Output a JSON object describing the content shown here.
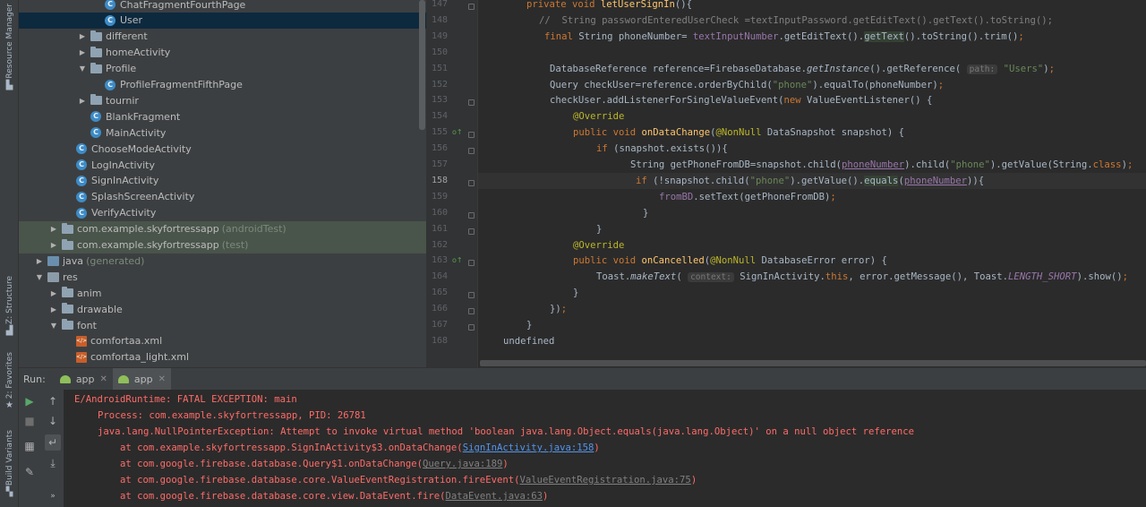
{
  "left_strip": {
    "resource_manager": "Resource Manager",
    "structure": "Z: Structure",
    "favorites": "2: Favorites",
    "build_variants": "Build Variants"
  },
  "tree": [
    {
      "label": "ChatFragmentFourthPage",
      "icon": "class-icon",
      "indent": 4,
      "arrow": ""
    },
    {
      "label": "User",
      "icon": "class-icon",
      "indent": 4,
      "arrow": "",
      "selected": true
    },
    {
      "label": "different",
      "icon": "folder-icon",
      "indent": 3,
      "arrow": "▶"
    },
    {
      "label": "homeActivity",
      "icon": "folder-icon",
      "indent": 3,
      "arrow": "▶"
    },
    {
      "label": "Profile",
      "icon": "folder-icon",
      "indent": 3,
      "arrow": "▼"
    },
    {
      "label": "ProfileFragmentFifthPage",
      "icon": "class-icon",
      "indent": 4,
      "arrow": ""
    },
    {
      "label": "tournir",
      "icon": "folder-icon",
      "indent": 3,
      "arrow": "▶"
    },
    {
      "label": "BlankFragment",
      "icon": "class-icon",
      "indent": 3,
      "arrow": ""
    },
    {
      "label": "MainActivity",
      "icon": "class-icon",
      "indent": 3,
      "arrow": ""
    },
    {
      "label": "ChooseModeActivity",
      "icon": "class-icon",
      "indent": 2,
      "arrow": ""
    },
    {
      "label": "LogInActivity",
      "icon": "class-icon",
      "indent": 2,
      "arrow": ""
    },
    {
      "label": "SignInActivity",
      "icon": "class-icon",
      "indent": 2,
      "arrow": ""
    },
    {
      "label": "SplashScreenActivity",
      "icon": "class-icon",
      "indent": 2,
      "arrow": ""
    },
    {
      "label": "VerifyActivity",
      "icon": "class-icon",
      "indent": 2,
      "arrow": ""
    },
    {
      "label": "com.example.skyfortressapp",
      "hint": "(androidTest)",
      "icon": "folder-icon",
      "indent": 1,
      "arrow": "▶",
      "test": true
    },
    {
      "label": "com.example.skyfortressapp",
      "hint": "(test)",
      "icon": "folder-icon",
      "indent": 1,
      "arrow": "▶",
      "test": true
    },
    {
      "label": "java",
      "hint": "(generated)",
      "icon": "java-folder-icon",
      "indent": 0,
      "arrow": "▶"
    },
    {
      "label": "res",
      "icon": "res-folder-icon",
      "indent": 0,
      "arrow": "▼"
    },
    {
      "label": "anim",
      "icon": "folder-icon",
      "indent": 1,
      "arrow": "▶"
    },
    {
      "label": "drawable",
      "icon": "folder-icon",
      "indent": 1,
      "arrow": "▶"
    },
    {
      "label": "font",
      "icon": "folder-icon",
      "indent": 1,
      "arrow": "▼"
    },
    {
      "label": "comfortaa.xml",
      "icon": "xml-icon",
      "indent": 2,
      "arrow": ""
    },
    {
      "label": "comfortaa_light.xml",
      "icon": "xml-icon",
      "indent": 2,
      "arrow": ""
    }
  ],
  "editor": {
    "line_numbers": [
      "147",
      "148",
      "149",
      "150",
      "151",
      "152",
      "153",
      "154",
      "155",
      "156",
      "157",
      "158",
      "159",
      "160",
      "161",
      "162",
      "163",
      "164",
      "165",
      "166",
      "167",
      "168"
    ],
    "current_line": "158",
    "lines": [
      "<span class='kw'>private void </span><span class='fn'>letUserSignIn</span>(){",
      "<span class='cm'>//  String passwordEnteredUserCheck =textInputPassword.getEditText().getText().toString();</span>",
      "<span class='kw'>final </span>String phoneNumber= <span class='fld'>textInputNumber</span>.getEditText().<span class='hl'>getText</span>().toString().trim()<span class='kw'>;</span>",
      "",
      "DatabaseReference reference=FirebaseDatabase.<i>getInstance</i>().getReference( <span class='hint'>path:</span> <span class='str'>\"Users\"</span>)<span class='kw'>;</span>",
      "Query checkUser=reference.orderByChild(<span class='str'>\"phone\"</span>).equalTo(phoneNumber)<span class='kw'>;</span>",
      "checkUser.addListenerForSingleValueEvent(<span class='kw'>new </span>ValueEventListener() {",
      "<span class='ann'>@Override</span>",
      "<span class='kw'>public void </span><span class='fn'>onDataChange</span>(<span class='ann'>@NonNull </span>DataSnapshot snapshot) {",
      "<span class='kw'>if </span>(snapshot.exists()){",
      "String getPhoneFromDB=snapshot.child(<span class='fld und'>phoneNumber</span>).child(<span class='str'>\"phone\"</span>).getValue(String.<span class='kw'>class</span>)<span class='kw'>;</span>",
      "<span class='kw'>if </span>(!snapshot.child(<span class='str'>\"phone\"</span>).getValue().<span class='hl'>equals</span>(<span class='fld und'>phoneNumber</span>)){",
      "<span class='fld'>fromBD</span>.setText(getPhoneFromDB)<span class='kw'>;</span>",
      "}",
      "}",
      "<span class='ann'>@Override</span>",
      "<span class='kw'>public void </span><span class='fn'>onCancelled</span>(<span class='ann'>@NonNull </span>DatabaseError error) {",
      "Toast.<i>makeText</i>( <span class='hint'>context:</span> SignInActivity.<span class='kw'>this</span>, error.getMessage(), Toast.<span class='it'>LENGTH_SHORT</span>).show()<span class='kw'>;</span>",
      "}",
      "})<span class='kw'>;</span>",
      "}"
    ]
  },
  "run": {
    "title": "Run:",
    "tabs": [
      "app",
      "app"
    ]
  },
  "console": [
    {
      "text": "E/AndroidRuntime: FATAL EXCEPTION: main",
      "indent": 0
    },
    {
      "text": "Process: com.example.skyfortressapp, PID: 26781",
      "indent": 1
    },
    {
      "text": "java.lang.NullPointerException: Attempt to invoke virtual method 'boolean java.lang.Object.equals(java.lang.Object)' on a null object reference",
      "indent": 1
    },
    {
      "prefix": "at com.example.skyfortressapp.SignInActivity$3.onDataChange(",
      "link": "SignInActivity.java:158",
      "suffix": ")",
      "indent": 2,
      "link_style": "blue"
    },
    {
      "prefix": "at com.google.firebase.database.Query$1.onDataChange(",
      "link": "Query.java:189",
      "suffix": ")",
      "indent": 2,
      "link_style": "gray"
    },
    {
      "prefix": "at com.google.firebase.database.core.ValueEventRegistration.fireEvent(",
      "link": "ValueEventRegistration.java:75",
      "suffix": ")",
      "indent": 2,
      "link_style": "gray"
    },
    {
      "prefix": "at com.google.firebase.database.core.view.DataEvent.fire(",
      "link": "DataEvent.java:63",
      "suffix": ")",
      "indent": 2,
      "link_style": "gray"
    }
  ]
}
